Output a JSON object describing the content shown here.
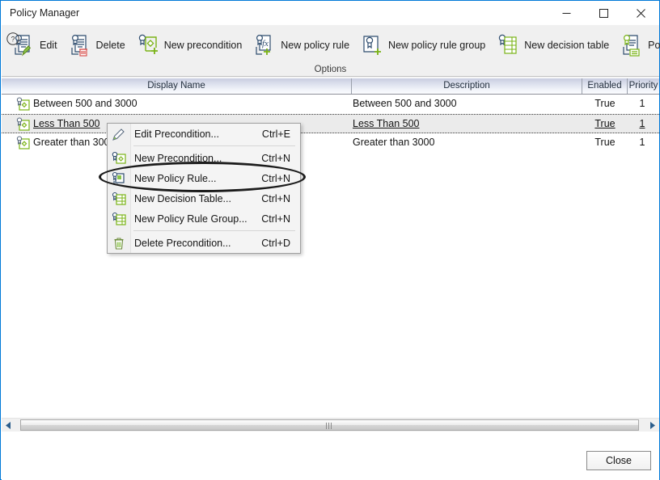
{
  "window": {
    "title": "Policy Manager",
    "controls": [
      {
        "name": "minimize",
        "glyph": "minimize-icon"
      },
      {
        "name": "maximize",
        "glyph": "maximize-icon"
      },
      {
        "name": "close",
        "glyph": "close-icon"
      }
    ]
  },
  "ribbon": {
    "group_label": "Options",
    "items": [
      {
        "label": "Edit",
        "icon": "edit-policy-icon"
      },
      {
        "label": "Delete",
        "icon": "delete-policy-icon"
      },
      {
        "label": "New precondition",
        "icon": "new-precondition-icon"
      },
      {
        "label": "New policy rule",
        "icon": "new-policy-rule-icon"
      },
      {
        "label": "New policy rule group",
        "icon": "new-policy-rule-group-icon"
      },
      {
        "label": "New decision table",
        "icon": "new-decision-table-icon"
      },
      {
        "label": "Policy Info",
        "icon": "policy-info-icon"
      }
    ]
  },
  "grid": {
    "columns": [
      {
        "label": "Display Name"
      },
      {
        "label": "Description"
      },
      {
        "label": "Enabled"
      },
      {
        "label": "Priority"
      }
    ],
    "rows": [
      {
        "display_name": "Between 500 and 3000",
        "description": "Between 500 and 3000",
        "enabled": "True",
        "priority": "1",
        "icon": "precondition-icon",
        "selected": false
      },
      {
        "display_name": "Less Than 500",
        "description": "Less Than 500",
        "enabled": "True",
        "priority": "1",
        "icon": "precondition-icon",
        "selected": true
      },
      {
        "display_name": "Greater than 3000",
        "description": "Greater than 3000",
        "enabled": "True",
        "priority": "1",
        "icon": "precondition-icon",
        "selected": false
      }
    ]
  },
  "context_menu": {
    "items": [
      {
        "label": "Edit Precondition...",
        "shortcut": "Ctrl+E",
        "icon": "pencil-icon"
      },
      {
        "label": "New Precondition...",
        "shortcut": "Ctrl+N",
        "icon": "new-precondition-icon"
      },
      {
        "label": "New Policy Rule...",
        "shortcut": "Ctrl+N",
        "icon": "new-policy-rule-icon",
        "highlighted": true
      },
      {
        "label": "New Decision Table...",
        "shortcut": "Ctrl+N",
        "icon": "new-decision-table-icon"
      },
      {
        "label": "New Policy Rule Group...",
        "shortcut": "Ctrl+N",
        "icon": "new-policy-rule-group-icon"
      },
      {
        "label": "Delete Precondition...",
        "shortcut": "Ctrl+D",
        "icon": "trash-icon"
      }
    ]
  },
  "footer": {
    "help_icon": "help-icon",
    "close_label": "Close"
  },
  "scrollbar": {
    "left_arrow": "scroll-left-icon",
    "right_arrow": "scroll-right-icon"
  },
  "colors": {
    "window_border": "#0078d7",
    "ribbon_bg": "#f0f0f0",
    "header_gradient_top": "#c9cde0",
    "selection_bg": "#ebebeb",
    "icon_green": "#7ab317",
    "icon_blue": "#2e4c6e",
    "annotation": "#1c1c1c"
  }
}
